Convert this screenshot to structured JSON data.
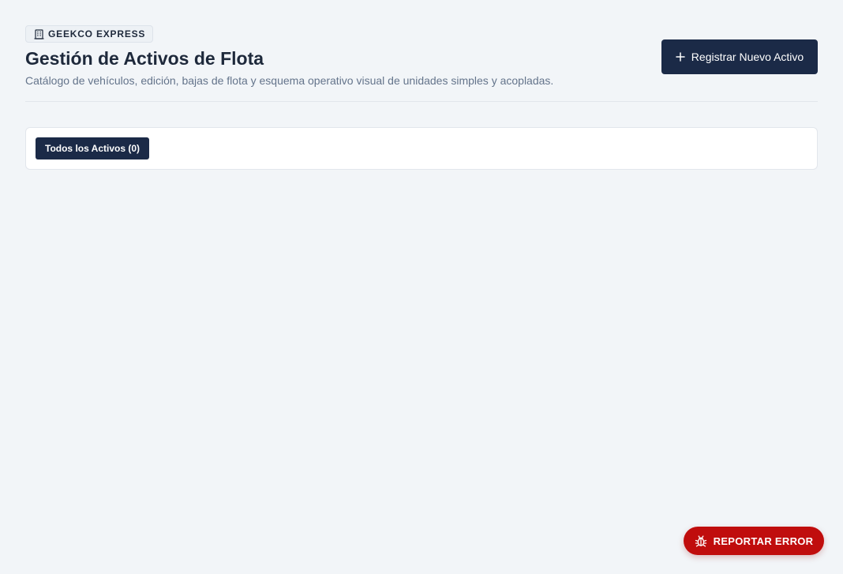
{
  "brand": {
    "name": "GEEKCO EXPRESS",
    "icon": "building-icon"
  },
  "header": {
    "title": "Gestión de Activos de Flota",
    "subtitle": "Catálogo de vehículos, edición, bajas de flota y esquema operativo visual de unidades simples y acopladas.",
    "primary_action": {
      "label": "Registrar Nuevo Activo",
      "icon": "plus-icon"
    }
  },
  "filters": {
    "tabs": [
      {
        "label": "Todos los Activos (0)",
        "active": true
      }
    ]
  },
  "report": {
    "label": "REPORTAR ERROR",
    "icon": "bug-icon"
  },
  "colors": {
    "background": "#f2f5f8",
    "primary": "#1b2a47",
    "danger": "#c00d0d",
    "text": "#1e293b",
    "muted": "#64748b"
  }
}
